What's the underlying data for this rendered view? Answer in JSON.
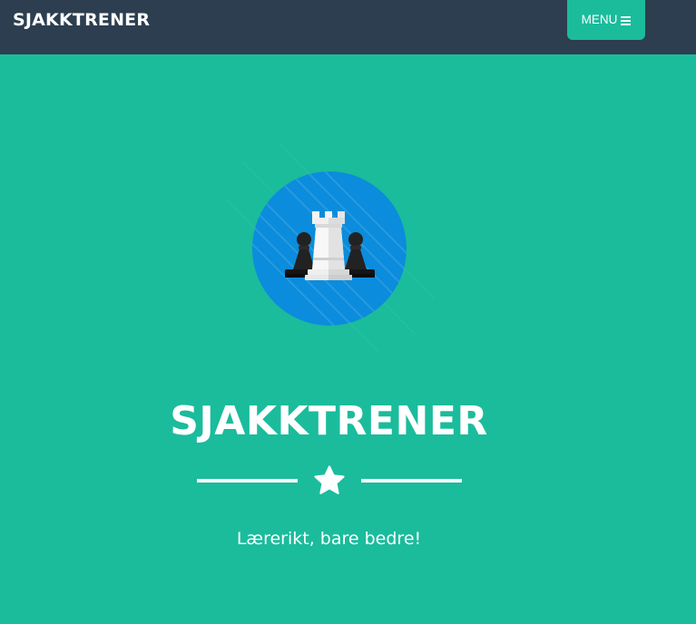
{
  "navbar": {
    "brand": "SJAKKTRENER",
    "menu_label": "MENU",
    "menu_icon": "hamburger-icon"
  },
  "hero": {
    "image_icon": "chess-rook-and-pawns-icon",
    "title": "SJAKKTRENER",
    "divider_icon": "star-icon",
    "subtitle": "Lærerikt, bare bedre!"
  },
  "colors": {
    "primary": "#1abc9c",
    "navbar": "#2c3e50",
    "avatar_circle": "#0b8cdc",
    "text": "#ffffff"
  }
}
